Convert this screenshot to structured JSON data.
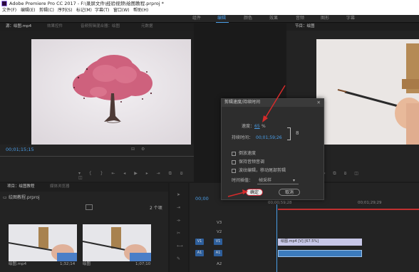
{
  "window": {
    "title": "Adobe Premiere Pro CC 2017 - F:\\录屏文件\\经验视频\\绘图教程.prproj *"
  },
  "menu": [
    "文件(F)",
    "编辑(E)",
    "剪辑(C)",
    "序列(S)",
    "标记(M)",
    "字幕(T)",
    "窗口(W)",
    "帮助(H)"
  ],
  "workspaces": [
    "组件",
    "编辑",
    "颜色",
    "效果",
    "音频",
    "图形",
    "字幕"
  ],
  "workspace_active": "编辑",
  "source_panel": {
    "tabs": [
      "源：绘图.mp4",
      "效果控件",
      "音频剪辑混合器：绘图",
      "元数据"
    ],
    "timecode": "00;01;15;15"
  },
  "program_panel": {
    "tabs": [
      "节目：绘图"
    ]
  },
  "project_panel": {
    "tabs": [
      "项目：绘图教程",
      "媒体浏览器"
    ],
    "filename": "绘图教程.prproj",
    "item_count": "2 个项",
    "clips": [
      {
        "name": "绘图.mp4",
        "duration": "1;32;14"
      },
      {
        "name": "绘图",
        "duration": "1;07;10"
      }
    ]
  },
  "timeline": {
    "timecode": "00;00",
    "ruler": [
      "00;00;59;28",
      "00;01;29;29"
    ],
    "tracks": [
      {
        "name": "V3"
      },
      {
        "name": "V2"
      },
      {
        "name": "V1",
        "src": "V1"
      },
      {
        "name": "A1",
        "src": "A1"
      },
      {
        "name": "A2"
      }
    ],
    "clip_label": "绘图.mp4 [V] [67.5%]"
  },
  "dialog": {
    "title": "剪辑速度/持续时间",
    "speed_label": "速度：",
    "speed_value": "65",
    "speed_unit": "%",
    "duration_label": "持续时间：",
    "duration_value": "00;01;59;26",
    "checkboxes": [
      {
        "label": "倒放速度",
        "checked": false
      },
      {
        "label": "保持音频音调",
        "checked": false
      },
      {
        "label": "波纹编辑，移动尾部剪辑",
        "checked": false
      }
    ],
    "interp_label": "时间插值：",
    "interp_value": "帧采样",
    "ok": "确定",
    "cancel": "取消"
  },
  "colors": {
    "accent": "#4a9ee8",
    "arrow": "#d52b2b",
    "dialog_bg": "#2d2d2d",
    "clip_video": "#c7c7e8",
    "clip_audio": "#3c7bbd"
  }
}
